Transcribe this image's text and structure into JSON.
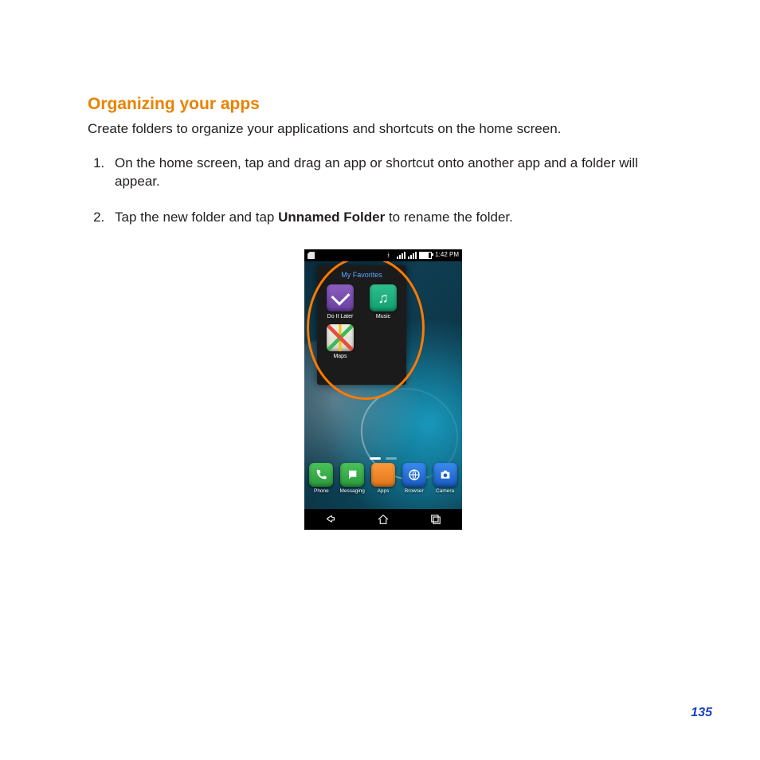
{
  "heading": "Organizing your apps",
  "intro": "Create folders to organize your applications and shortcuts on the home screen.",
  "steps": [
    "On the home screen, tap and drag an app or shortcut onto another app and a folder will appear.",
    {
      "pre": "Tap the new folder and tap ",
      "bold": "Unnamed Folder",
      "post": " to rename the folder."
    }
  ],
  "phone": {
    "status": {
      "time": "1:42 PM"
    },
    "folder": {
      "title": "My Favorites",
      "apps": [
        {
          "label": "Do It Later",
          "icon": "doit"
        },
        {
          "label": "Music",
          "icon": "music"
        },
        {
          "label": "Maps",
          "icon": "maps"
        }
      ]
    },
    "dock": [
      {
        "label": "Phone",
        "icon": "phone"
      },
      {
        "label": "Messaging",
        "icon": "msg"
      },
      {
        "label": "Apps",
        "icon": "apps"
      },
      {
        "label": "Browser",
        "icon": "browser"
      },
      {
        "label": "Camera",
        "icon": "camera"
      }
    ]
  },
  "page_number": "135"
}
